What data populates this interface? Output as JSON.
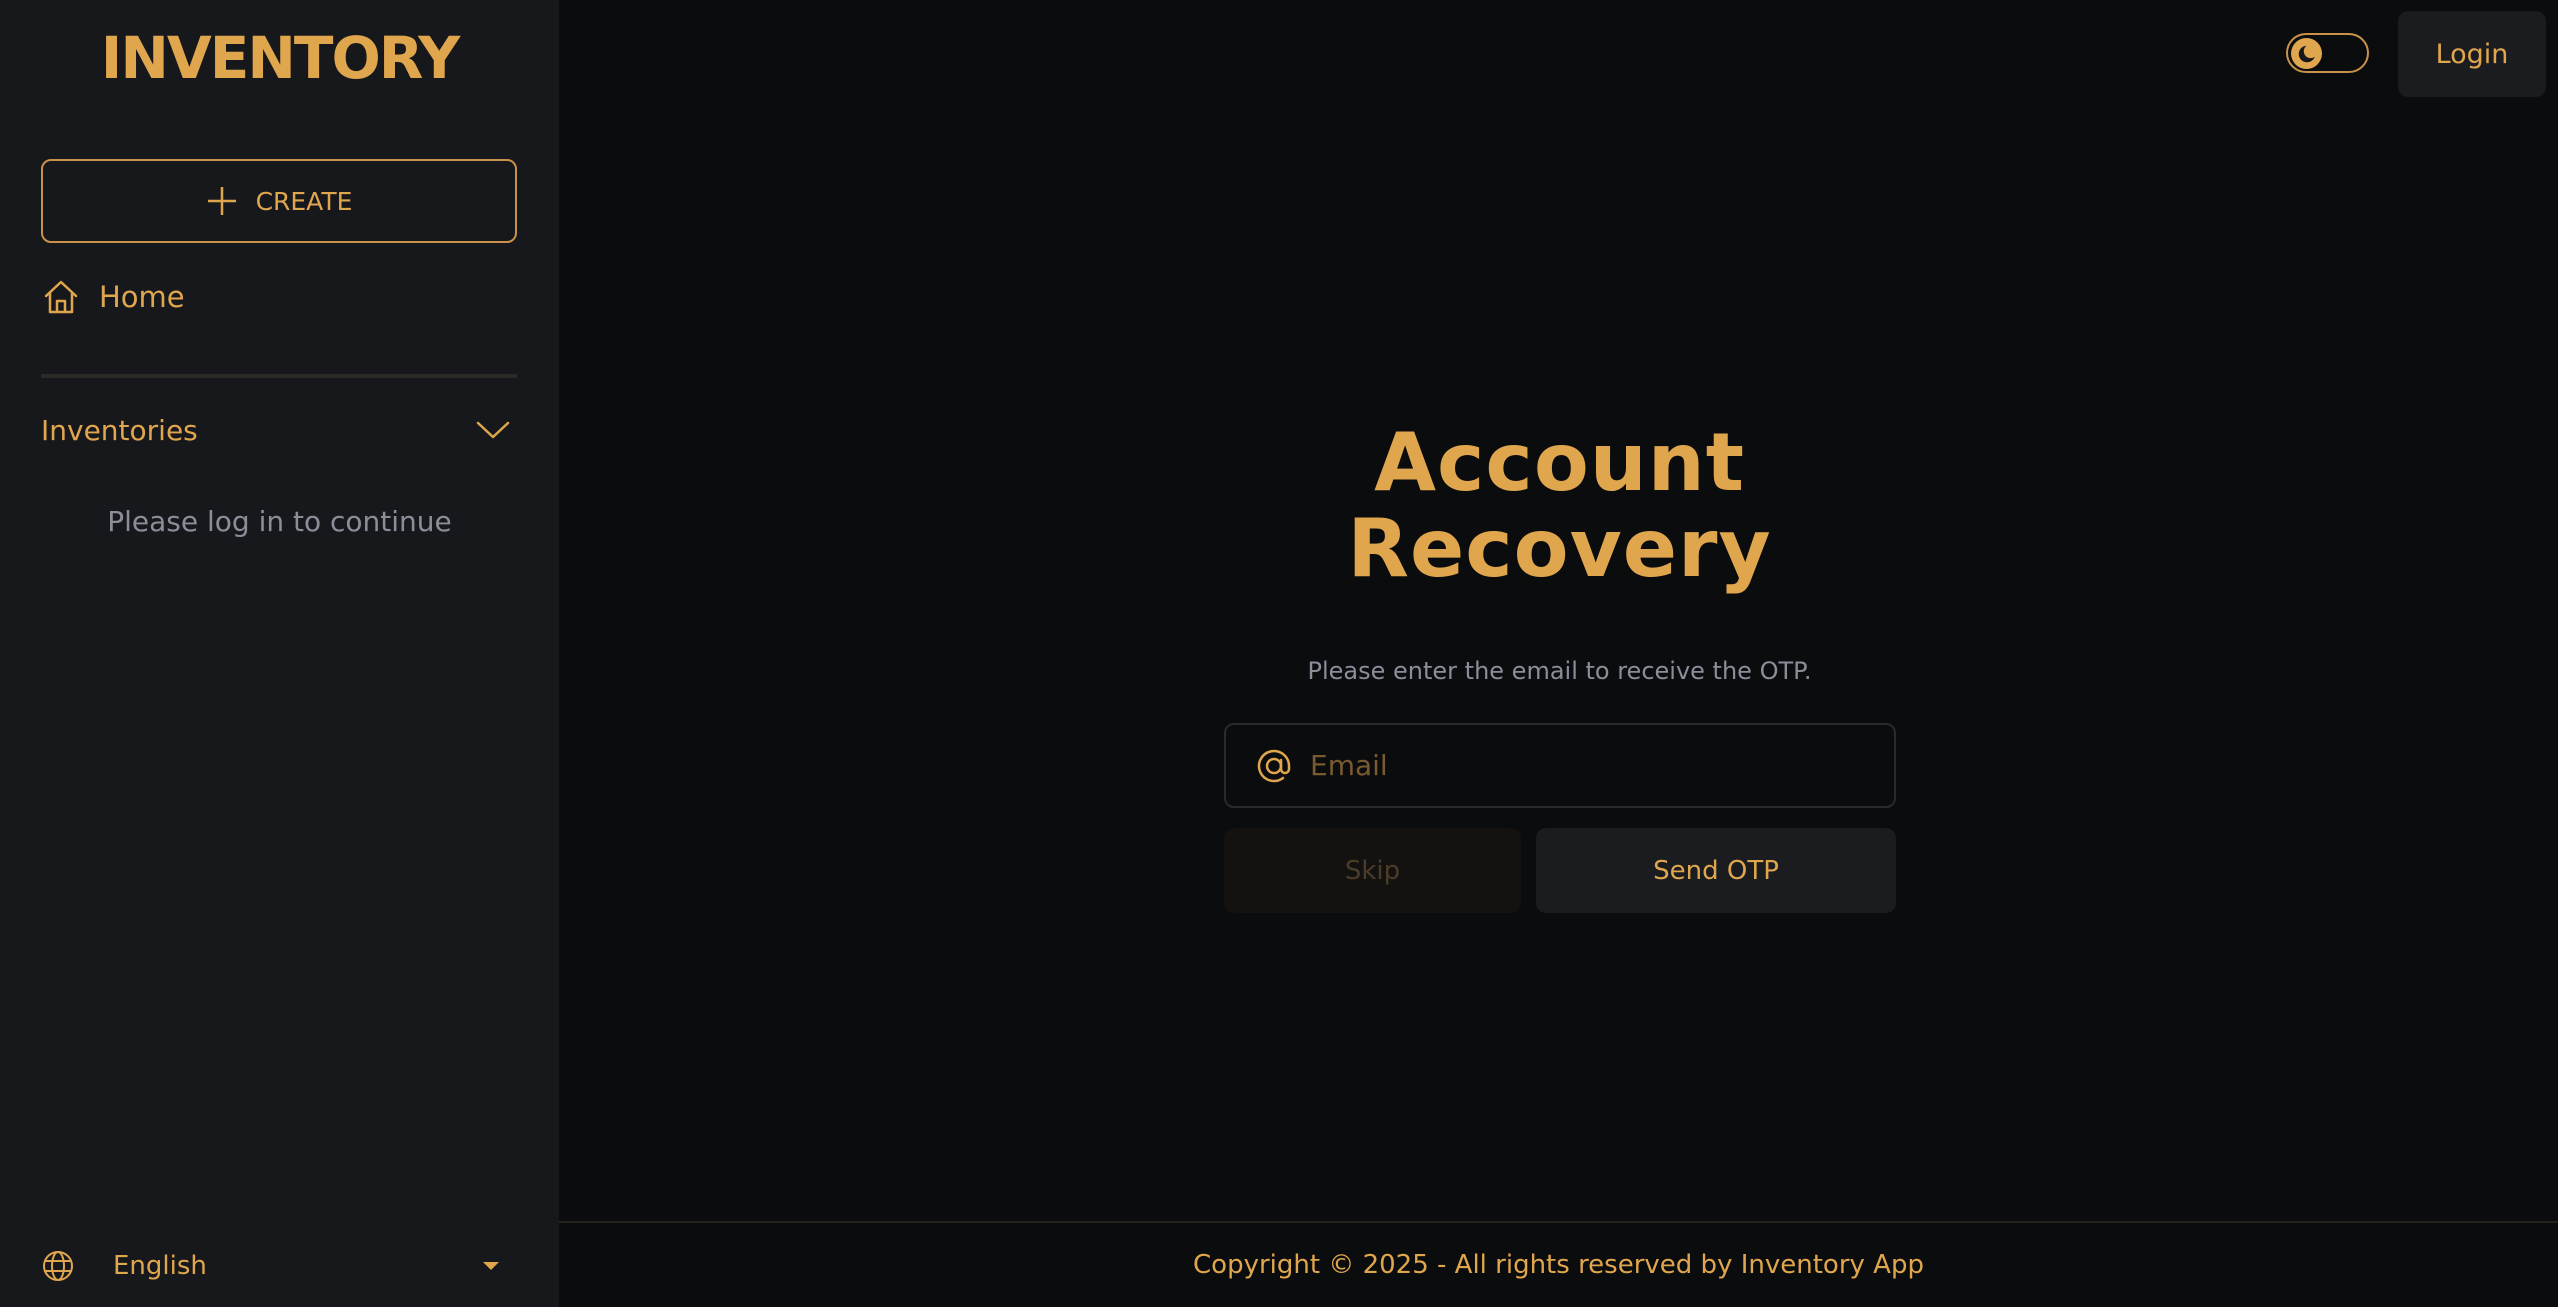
{
  "colors": {
    "accent": "#e0a64e",
    "sidebar_bg": "#17181b",
    "main_bg": "#0b0c0e",
    "muted_text": "#8a8e99"
  },
  "sidebar": {
    "logo": "INVENTORY",
    "create_label": "CREATE",
    "home_label": "Home",
    "inventories_label": "Inventories",
    "login_hint": "Please log in to continue",
    "language": "English"
  },
  "header": {
    "login_label": "Login",
    "theme_icon": "moon-icon"
  },
  "recovery": {
    "title_line1": "Account",
    "title_line2": "Recovery",
    "subtitle": "Please enter the email to receive the OTP.",
    "email_placeholder": "Email",
    "email_value": "",
    "skip_label": "Skip",
    "send_label": "Send OTP"
  },
  "footer": {
    "copyright": "Copyright © 2025 - All rights reserved by Inventory App"
  }
}
